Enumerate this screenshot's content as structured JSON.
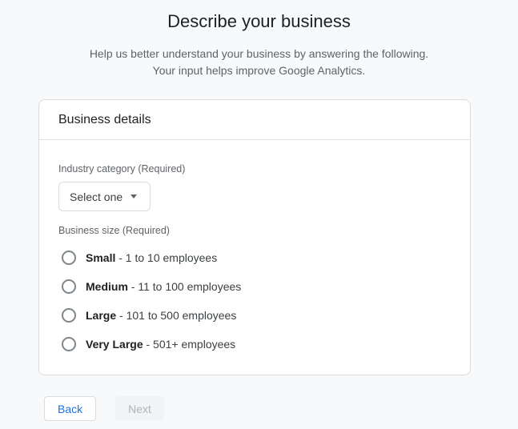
{
  "page": {
    "title": "Describe your business",
    "subtitle_line1": "Help us better understand your business by answering the following.",
    "subtitle_line2": "Your input helps improve Google Analytics."
  },
  "card": {
    "title": "Business details",
    "industry": {
      "label": "Industry category (Required)",
      "dropdown_value": "Select one",
      "dropdown_icon": "caret-down-icon"
    },
    "business_size": {
      "label": "Business size (Required)",
      "options": [
        {
          "name": "Small",
          "desc": "- 1 to 10 employees",
          "selected": false
        },
        {
          "name": "Medium",
          "desc": "- 11 to 100 employees",
          "selected": false
        },
        {
          "name": "Large",
          "desc": "- 101 to 500 employees",
          "selected": false
        },
        {
          "name": "Very Large",
          "desc": "- 501+ employees",
          "selected": false
        }
      ]
    }
  },
  "footer": {
    "back_label": "Back",
    "next_label": "Next",
    "next_disabled": true
  },
  "colors": {
    "background": "#f8f9fa",
    "card_border": "#dadce0",
    "accent_blue": "#1a73e8",
    "text_primary": "#202124",
    "text_secondary": "#5f6368",
    "disabled_button_bg": "#f1f3f4",
    "disabled_button_text": "#b0b4b8"
  }
}
